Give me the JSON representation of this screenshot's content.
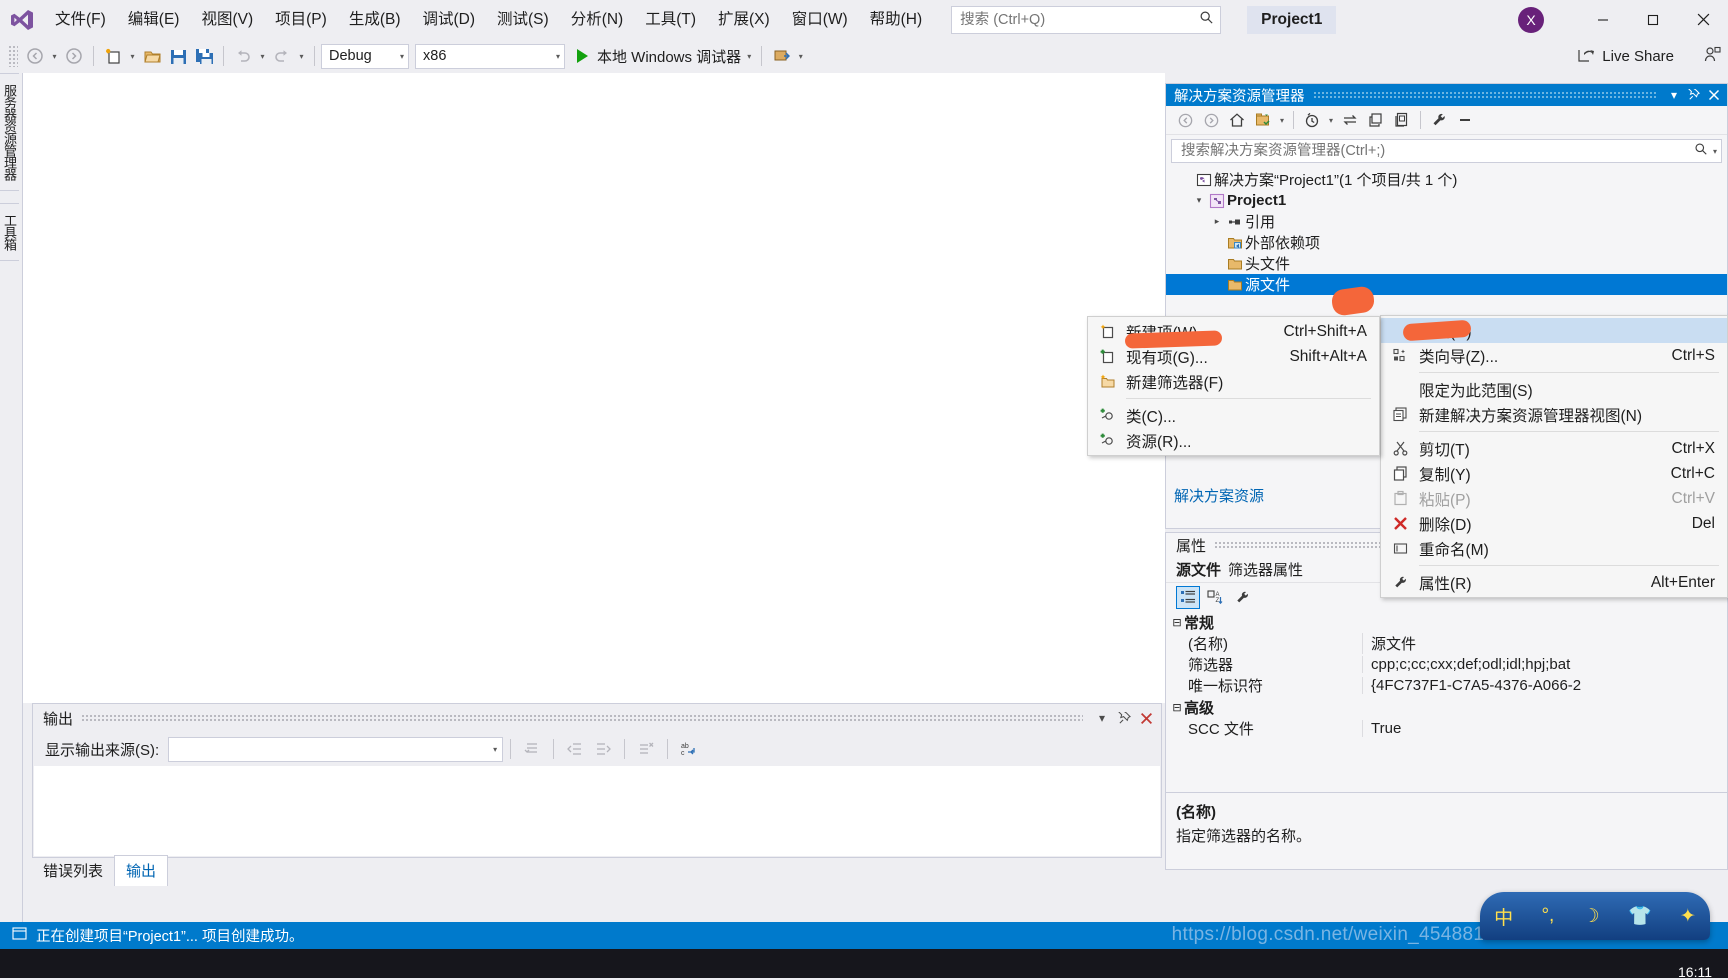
{
  "app": {
    "logo_icon": "visual-studio-logo",
    "project_chip": "Project1",
    "avatar_initial": "X",
    "accent_blue": "#007acc",
    "brand_purple": "#68217a",
    "selection_blue": "#0078d4"
  },
  "menubar": {
    "items": [
      {
        "label": "文件(F)"
      },
      {
        "label": "编辑(E)"
      },
      {
        "label": "视图(V)"
      },
      {
        "label": "项目(P)"
      },
      {
        "label": "生成(B)"
      },
      {
        "label": "调试(D)"
      },
      {
        "label": "测试(S)"
      },
      {
        "label": "分析(N)"
      },
      {
        "label": "工具(T)"
      },
      {
        "label": "扩展(X)"
      },
      {
        "label": "窗口(W)"
      },
      {
        "label": "帮助(H)"
      }
    ]
  },
  "quick_search": {
    "placeholder": "搜索 (Ctrl+Q)",
    "value": "",
    "icon": "search-icon"
  },
  "window_controls": {
    "minimize": "—",
    "maximize": "▢",
    "close": "✕"
  },
  "toolbar": {
    "back_icon": "navigate-back-icon",
    "forward_icon": "navigate-forward-icon",
    "new_project_icon": "new-project-icon",
    "open_icon": "open-file-icon",
    "save_icon": "save-icon",
    "save_all_icon": "save-all-icon",
    "undo_icon": "undo-icon",
    "redo_icon": "redo-icon",
    "config_value": "Debug",
    "platform_value": "x86",
    "run_label": "本地 Windows 调试器",
    "run_icon": "play-icon",
    "attach_icon": "attach-process-icon",
    "live_share_label": "Live Share",
    "live_share_icon": "live-share-icon",
    "collab_icon": "collaboration-icon"
  },
  "left_rail": {
    "tabs": [
      {
        "label": "服务器资源管理器"
      },
      {
        "label": "工具箱"
      }
    ]
  },
  "output_panel": {
    "title": "输出",
    "dropdown_icon": "chevron-down-icon",
    "pin_icon": "pin-icon",
    "close_icon": "close-icon",
    "source_label": "显示输出来源(S):",
    "source_value": "",
    "body_text": "",
    "tool_icons": [
      "go-to-message-icon",
      "previous-message-icon",
      "next-message-icon",
      "clear-all-icon",
      "word-wrap-icon"
    ]
  },
  "bottom_tabs": {
    "items": [
      {
        "label": "错误列表",
        "active": false
      },
      {
        "label": "输出",
        "active": true
      }
    ]
  },
  "solution_explorer": {
    "title": "解决方案资源管理器",
    "header_buttons": [
      "chevron-down-icon",
      "pin-icon",
      "close-icon"
    ],
    "toolbar_icons": [
      "back-icon",
      "forward-icon",
      "home-icon",
      "show-all-files-icon",
      "pending-changes-icon",
      "sync-with-active-document-icon",
      "refresh-icon",
      "collapse-all-icon",
      "properties-icon",
      "collapse-icon"
    ],
    "search_placeholder": "搜索解决方案资源管理器(Ctrl+;)",
    "search_value": "",
    "tree": [
      {
        "label": "解决方案“Project1”(1 个项目/共 1 个)",
        "icon": "solution-icon",
        "indent": 0,
        "twist": "",
        "bold": false,
        "selected": false
      },
      {
        "label": "Project1",
        "icon": "cpp-project-icon",
        "indent": 1,
        "twist": "▾",
        "bold": true,
        "selected": false
      },
      {
        "label": "引用",
        "icon": "references-icon",
        "indent": 2,
        "twist": "▸",
        "bold": false,
        "selected": false
      },
      {
        "label": "外部依赖项",
        "icon": "external-deps-folder-icon",
        "indent": 3,
        "twist": "",
        "bold": false,
        "selected": false
      },
      {
        "label": "头文件",
        "icon": "filter-folder-icon",
        "indent": 3,
        "twist": "",
        "bold": false,
        "selected": false
      },
      {
        "label": "源文件",
        "icon": "filter-folder-icon",
        "indent": 3,
        "twist": "",
        "bold": false,
        "selected": true
      }
    ],
    "link_text": "解决方案资源"
  },
  "properties": {
    "title": "属性",
    "object_name": "源文件",
    "object_type": "筛选器属性",
    "dropdown_icon": "chevron-down-icon",
    "toolbar_icons": [
      "categorized-icon",
      "alphabetical-sort-icon",
      "property-pages-icon"
    ],
    "groups": [
      {
        "name": "常规",
        "expander": "⊟",
        "rows": [
          {
            "key": "(名称)",
            "value": "源文件"
          },
          {
            "key": "筛选器",
            "value": "cpp;c;cc;cxx;def;odl;idl;hpj;bat"
          },
          {
            "key": "唯一标识符",
            "value": "{4FC737F1-C7A5-4376-A066-2"
          }
        ]
      },
      {
        "name": "高级",
        "expander": "⊟",
        "rows": [
          {
            "key": "SCC 文件",
            "value": "True"
          }
        ]
      }
    ],
    "description_title": "(名称)",
    "description_body": "指定筛选器的名称。"
  },
  "context_menu": {
    "items": [
      {
        "label": "添加(D)",
        "shortcut": "",
        "icon": "",
        "highlighted": true,
        "disabled": false,
        "separator_after": false
      },
      {
        "label": "类向导(Z)...",
        "shortcut": "Ctrl+S",
        "icon": "class-wizard-icon",
        "highlighted": false,
        "disabled": false,
        "separator_after": true
      },
      {
        "label": "限定为此范围(S)",
        "shortcut": "",
        "icon": "",
        "highlighted": false,
        "disabled": false,
        "separator_after": false
      },
      {
        "label": "新建解决方案资源管理器视图(N)",
        "shortcut": "",
        "icon": "new-view-icon",
        "highlighted": false,
        "disabled": false,
        "separator_after": true
      },
      {
        "label": "剪切(T)",
        "shortcut": "Ctrl+X",
        "icon": "cut-icon",
        "highlighted": false,
        "disabled": false,
        "separator_after": false
      },
      {
        "label": "复制(Y)",
        "shortcut": "Ctrl+C",
        "icon": "copy-icon",
        "highlighted": false,
        "disabled": false,
        "separator_after": false
      },
      {
        "label": "粘贴(P)",
        "shortcut": "Ctrl+V",
        "icon": "paste-icon",
        "highlighted": false,
        "disabled": true,
        "separator_after": false
      },
      {
        "label": "删除(D)",
        "shortcut": "Del",
        "icon": "delete-icon",
        "highlighted": false,
        "disabled": false,
        "separator_after": false
      },
      {
        "label": "重命名(M)",
        "shortcut": "",
        "icon": "rename-icon",
        "highlighted": false,
        "disabled": false,
        "separator_after": true
      },
      {
        "label": "属性(R)",
        "shortcut": "Alt+Enter",
        "icon": "properties-wrench-icon",
        "highlighted": false,
        "disabled": false,
        "separator_after": false
      }
    ]
  },
  "add_submenu": {
    "items": [
      {
        "label": "新建项(W)...",
        "shortcut": "Ctrl+Shift+A",
        "icon": "new-item-icon",
        "separator_after": false
      },
      {
        "label": "现有项(G)...",
        "shortcut": "Shift+Alt+A",
        "icon": "existing-item-icon",
        "separator_after": false
      },
      {
        "label": "新建筛选器(F)",
        "shortcut": "",
        "icon": "new-filter-icon",
        "separator_after": true
      },
      {
        "label": "类(C)...",
        "shortcut": "",
        "icon": "add-class-icon",
        "separator_after": false
      },
      {
        "label": "资源(R)...",
        "shortcut": "",
        "icon": "add-resource-icon",
        "separator_after": false
      }
    ]
  },
  "status_bar": {
    "text": "正在创建项目“Project1”... 项目创建成功。",
    "icon": "status-icon"
  },
  "ime_bar": {
    "glyphs": [
      "中",
      "°,",
      "☽",
      "👕",
      "✦"
    ]
  },
  "taskbar": {
    "clock": "16:11"
  },
  "watermark": {
    "text": "https://blog.csdn.net/weixin_45488131"
  }
}
